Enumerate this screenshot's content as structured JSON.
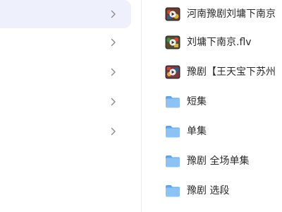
{
  "left_panel": {
    "rows": [
      {
        "selected": true
      },
      {
        "selected": false
      },
      {
        "selected": false
      },
      {
        "selected": false
      },
      {
        "selected": false
      }
    ],
    "chevron_icon": "chevron-right-icon",
    "selected_bg_color": "#eef1fb"
  },
  "files": [
    {
      "name": "河南豫剧刘墉下南京",
      "type": "video",
      "icon": "video-thumbnail-icon"
    },
    {
      "name": "刘墉下南京.flv",
      "type": "video",
      "icon": "video-thumbnail-icon"
    },
    {
      "name": "豫剧【王天宝下苏州",
      "type": "video",
      "icon": "video-thumbnail-icon"
    },
    {
      "name": "短集",
      "type": "folder",
      "icon": "folder-icon"
    },
    {
      "name": "单集",
      "type": "folder",
      "icon": "folder-icon"
    },
    {
      "name": "豫剧 全场单集",
      "type": "folder",
      "icon": "folder-icon"
    },
    {
      "name": "豫剧 选段",
      "type": "folder",
      "icon": "folder-icon"
    }
  ],
  "colors": {
    "folder": "#7cb9f2",
    "folder_tab": "#5da6ea",
    "text": "#2b2b2b",
    "chevron": "#8a8a8a"
  }
}
